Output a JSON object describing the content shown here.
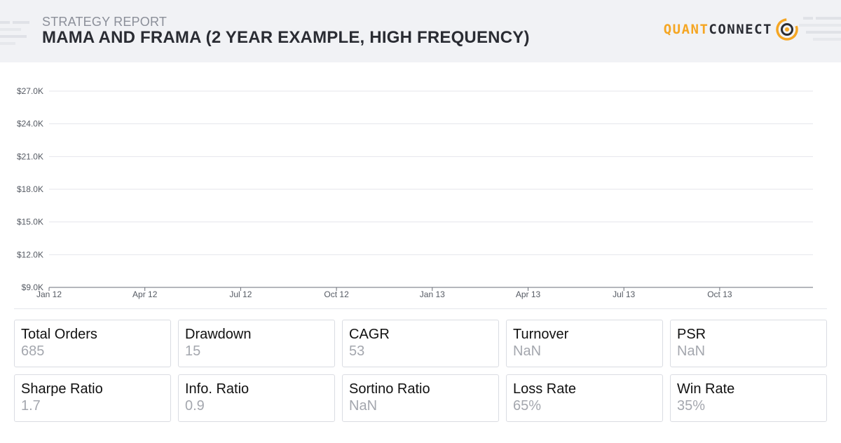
{
  "header": {
    "eyebrow": "STRATEGY REPORT",
    "title": "MAMA AND FRAMA (2 YEAR EXAMPLE, HIGH FREQUENCY)",
    "logo_text_quant": "QUANT",
    "logo_text_connect": "CONNECT"
  },
  "colors": {
    "accent": "#f5a623",
    "header_bg": "#f1f2f5",
    "title_text": "#2a2c33",
    "muted_text": "#a4a7ae",
    "gridline": "#e4e6eb"
  },
  "chart_data": {
    "type": "line",
    "title": "",
    "xlabel": "",
    "ylabel": "",
    "x_categories": [
      "Jan 12",
      "Apr 12",
      "Jul 12",
      "Oct 12",
      "Jan 13",
      "Apr 13",
      "Jul 13",
      "Oct 13"
    ],
    "y_ticks": [
      "$9.0K",
      "$12.0K",
      "$15.0K",
      "$18.0K",
      "$21.0K",
      "$24.0K",
      "$27.0K"
    ],
    "ylim": [
      9000,
      27000
    ],
    "grid": true,
    "series": []
  },
  "stats": [
    {
      "label": "Total Orders",
      "value": "685"
    },
    {
      "label": "Drawdown",
      "value": "15"
    },
    {
      "label": "CAGR",
      "value": "53"
    },
    {
      "label": "Turnover",
      "value": "NaN"
    },
    {
      "label": "PSR",
      "value": "NaN"
    },
    {
      "label": "Sharpe Ratio",
      "value": "1.7"
    },
    {
      "label": "Info. Ratio",
      "value": "0.9"
    },
    {
      "label": "Sortino Ratio",
      "value": "NaN"
    },
    {
      "label": "Loss Rate",
      "value": "65%"
    },
    {
      "label": "Win Rate",
      "value": "35%"
    }
  ]
}
